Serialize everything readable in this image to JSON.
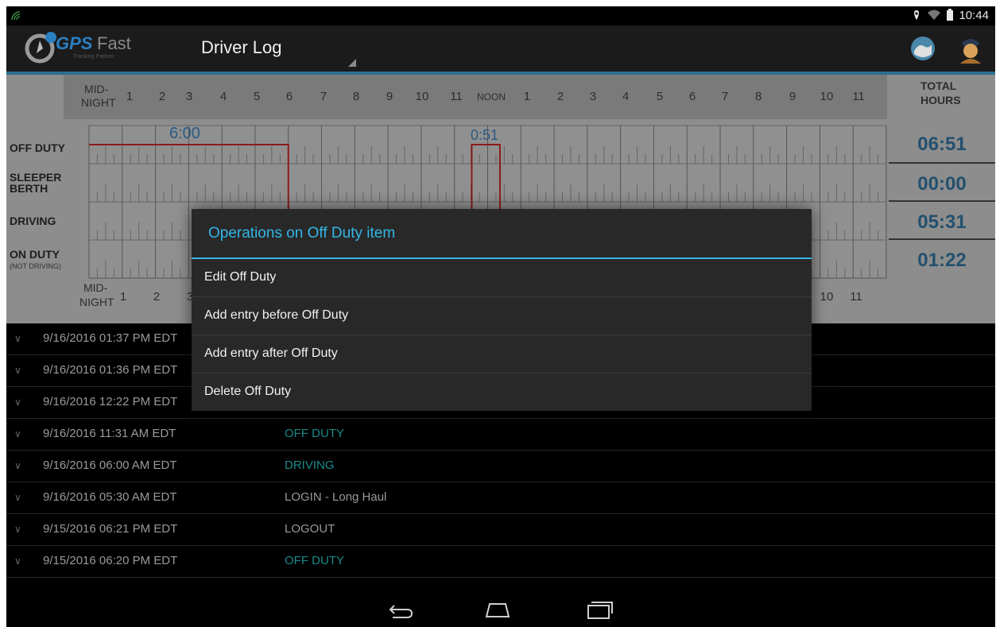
{
  "status_bar": {
    "time": "10:44"
  },
  "app": {
    "logo_gps": "GPS",
    "logo_fast": "Fast",
    "logo_tagline": "Tracking Partner",
    "title": "Driver Log"
  },
  "chart": {
    "top_axis": {
      "midnight_line1": "MID-",
      "midnight_line2": "NIGHT",
      "hours": [
        "1",
        "2",
        "3",
        "4",
        "5",
        "6",
        "7",
        "8",
        "9",
        "10",
        "11",
        "NOON",
        "1",
        "2",
        "3",
        "4",
        "5",
        "6",
        "7",
        "8",
        "9",
        "10",
        "11"
      ]
    },
    "bottom_axis": {
      "midnight_line1": "MID-",
      "midnight_line2": "NIGHT",
      "hours_left": [
        "1",
        "2",
        "3"
      ],
      "hours_right": [
        "10",
        "11"
      ]
    },
    "total_header_line1": "TOTAL",
    "total_header_line2": "HOURS",
    "rows": [
      {
        "label1": "OFF DUTY",
        "label2": "",
        "total": "06:51"
      },
      {
        "label1": "SLEEPER",
        "label2": "BERTH",
        "total": "00:00"
      },
      {
        "label1": "DRIVING",
        "label2": "",
        "total": "05:31"
      },
      {
        "label1": "ON DUTY",
        "label2": "(NOT DRIVING)",
        "total": "01:22"
      }
    ],
    "annotations": [
      "6:00",
      "0:51"
    ],
    "line_color": "#8b1a1a"
  },
  "list": [
    {
      "time": "9/16/2016 01:37 PM EDT",
      "status": ""
    },
    {
      "time": "9/16/2016 01:36 PM EDT",
      "status": ""
    },
    {
      "time": "9/16/2016 12:22 PM EDT",
      "status": ""
    },
    {
      "time": "9/16/2016 11:31 AM EDT",
      "status": "OFF DUTY",
      "color": "#1a8a8a"
    },
    {
      "time": "9/16/2016 06:00 AM EDT",
      "status": "DRIVING",
      "color": "#1a8a8a"
    },
    {
      "time": "9/16/2016 05:30 AM EDT",
      "status": "LOGIN - Long Haul",
      "color": "#9a9a9a"
    },
    {
      "time": "9/15/2016 06:21 PM EDT",
      "status": "LOGOUT",
      "color": "#9a9a9a"
    },
    {
      "time": "9/15/2016 06:20 PM EDT",
      "status": "OFF DUTY",
      "color": "#1a8a8a"
    }
  ],
  "dialog": {
    "title": "Operations on Off Duty item",
    "items": [
      "Edit Off Duty",
      "Add entry before Off Duty",
      "Add entry after Off Duty",
      "Delete Off Duty"
    ]
  },
  "colors": {
    "accent": "#33b5e5",
    "totals": "#23506e"
  }
}
